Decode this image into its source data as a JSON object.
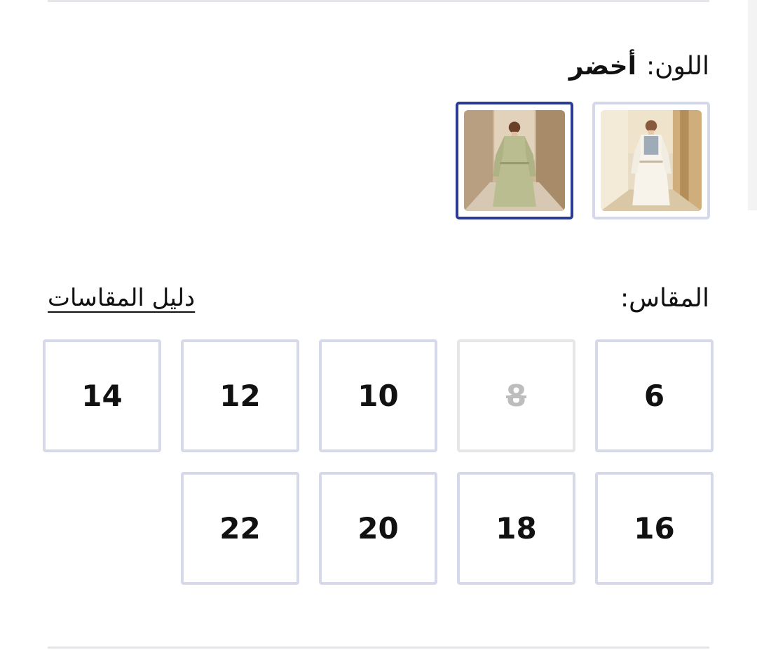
{
  "color": {
    "label": "اللون:",
    "selected_value": "أخضر",
    "swatches": [
      {
        "name": "white-dress",
        "color": "#efe9dc",
        "selected": false
      },
      {
        "name": "green-dress",
        "color": "#b9bd8f",
        "selected": true
      }
    ]
  },
  "size": {
    "label": "المقاس:",
    "guide_link": "دليل المقاسات",
    "options": [
      {
        "label": "6",
        "available": true
      },
      {
        "label": "8",
        "available": false
      },
      {
        "label": "10",
        "available": true
      },
      {
        "label": "12",
        "available": true
      },
      {
        "label": "14",
        "available": true
      },
      {
        "label": "16",
        "available": true
      },
      {
        "label": "18",
        "available": true
      },
      {
        "label": "20",
        "available": true
      },
      {
        "label": "22",
        "available": true
      }
    ]
  },
  "colors": {
    "selected_border": "#2b3a94",
    "default_border": "#d6d9ea",
    "disabled_text": "#bdbdbd"
  }
}
